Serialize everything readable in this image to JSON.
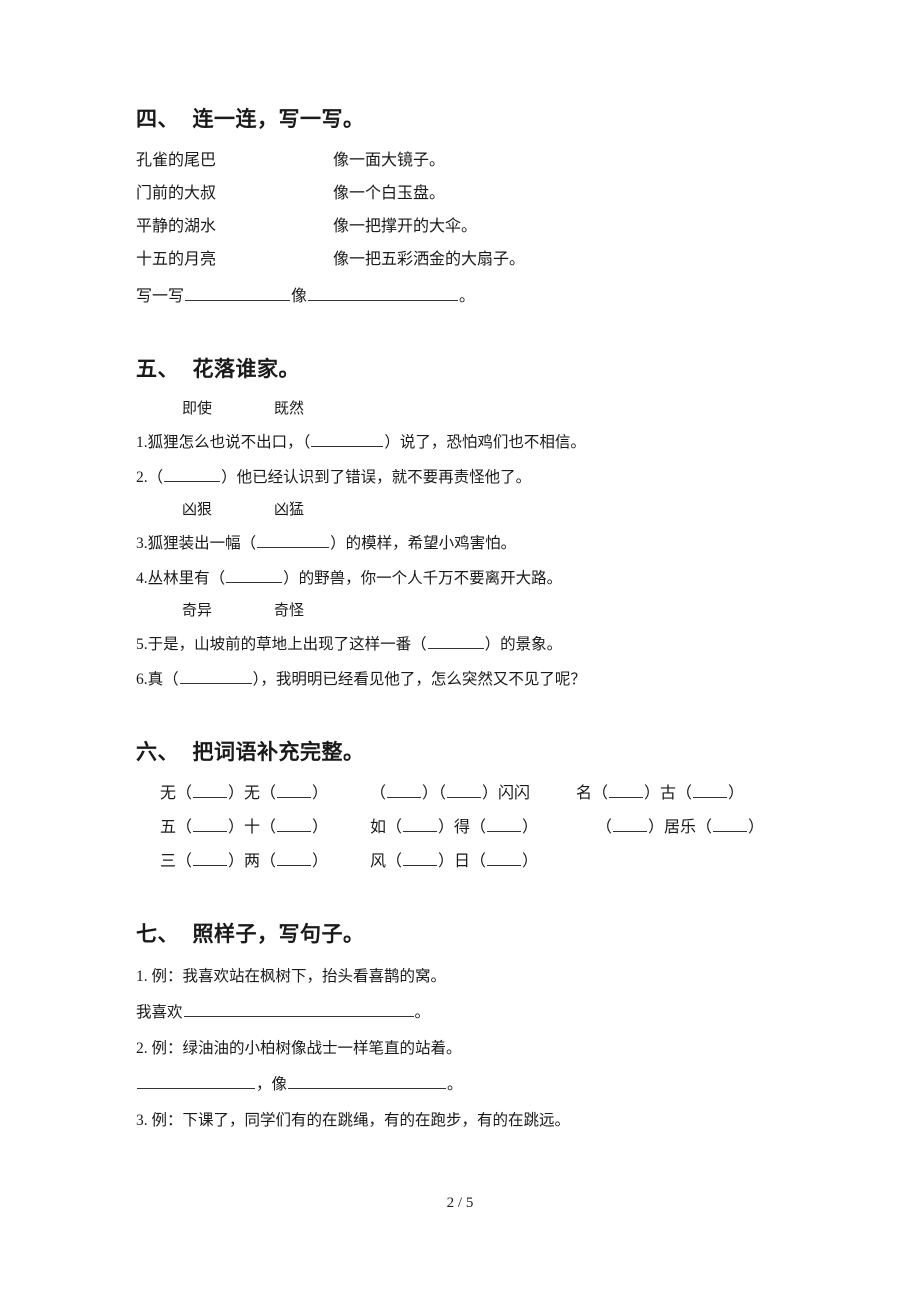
{
  "page": {
    "footer": "2 / 5"
  },
  "sections": [
    {
      "number": "四、",
      "title": "连一连，写一写。",
      "pairs": [
        {
          "left": "孔雀的尾巴",
          "right": "像一面大镜子。"
        },
        {
          "left": "门前的大叔",
          "right": "像一个白玉盘。"
        },
        {
          "left": "平静的湖水",
          "right": "像一把撑开的大伞。"
        },
        {
          "left": "十五的月亮",
          "right": "像一把五彩洒金的大扇子。"
        }
      ],
      "write_prompt": {
        "lead": "写一写",
        "middle": "像",
        "tail": "。"
      }
    },
    {
      "number": "五、",
      "title": "花落谁家。",
      "groups": [
        {
          "bank": [
            "即使",
            "既然"
          ],
          "questions": [
            {
              "num": "1.",
              "before": "狐狸怎么也说不出口，（",
              "after": "）说了，恐怕鸡们也不相信。"
            },
            {
              "num": "2.",
              "before": "（",
              "after": "）他已经认识到了错误，就不要再责怪他了。"
            }
          ]
        },
        {
          "bank": [
            "凶狠",
            "凶猛"
          ],
          "questions": [
            {
              "num": "3.",
              "before": "狐狸装出一幅（",
              "after": "）的模样，希望小鸡害怕。"
            },
            {
              "num": "4.",
              "before": "丛林里有（",
              "after": "）的野兽，你一个人千万不要离开大路。"
            }
          ]
        },
        {
          "bank": [
            "奇异",
            "奇怪"
          ],
          "questions": [
            {
              "num": "5.",
              "before": "于是，山坡前的草地上出现了这样一番（",
              "after": "）的景象。"
            },
            {
              "num": "6.",
              "before": "真（",
              "after": "），我明明已经看见他了，怎么突然又不见了呢？"
            }
          ]
        }
      ]
    },
    {
      "number": "六、",
      "title": "把词语补充完整。",
      "idiom_rows": [
        {
          "c1": {
            "a": "无（",
            "b": "）无（",
            "c": "）"
          },
          "c2": {
            "a": "（",
            "b": "）（",
            "c": "）闪闪"
          },
          "c3": {
            "a": "名（",
            "b": "）古（",
            "c": "）"
          }
        },
        {
          "c1": {
            "a": "五（",
            "b": "）十（",
            "c": "）"
          },
          "c2": {
            "a": "如（",
            "b": "）得（",
            "c": "）"
          },
          "c3": {
            "a": "（",
            "b": "）居乐（",
            "c": "）"
          }
        },
        {
          "c1": {
            "a": "三（",
            "b": "）两（",
            "c": "）"
          },
          "c2": {
            "a": "风（",
            "b": "）日（",
            "c": "）"
          },
          "c3": {
            "a": "",
            "b": "",
            "c": ""
          }
        }
      ]
    },
    {
      "number": "七、",
      "title": "照样子，写句子。",
      "items": [
        {
          "num": "1.",
          "example": "例：我喜欢站在枫树下，抬头看喜鹊的窝。",
          "fill_lead": "我喜欢",
          "fill_tail": "。"
        },
        {
          "num": "2.",
          "example": "例：绿油油的小柏树像战士一样笔直的站着。",
          "fill_lead": "",
          "fill_mid": "，像",
          "fill_tail": "。"
        },
        {
          "num": "3.",
          "example": "例：下课了，同学们有的在跳绳，有的在跑步，有的在跳远。"
        }
      ]
    }
  ]
}
